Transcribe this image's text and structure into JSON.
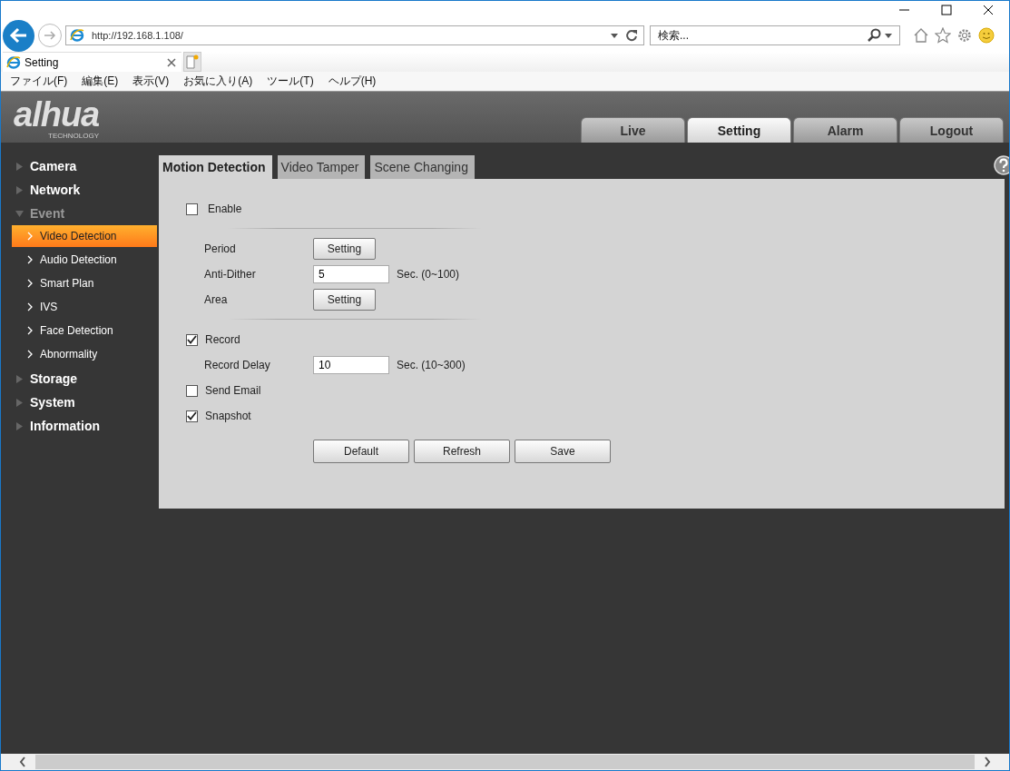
{
  "browser": {
    "url": "http://192.168.1.108/",
    "search": {
      "placeholder": "検索..."
    },
    "tab_title": "Setting",
    "menu": [
      "ファイル(F)",
      "編集(E)",
      "表示(V)",
      "お気に入り(A)",
      "ツール(T)",
      "ヘルプ(H)"
    ]
  },
  "header": {
    "logo": "alhua",
    "logo_sub": "TECHNOLOGY",
    "nav_tabs": [
      {
        "label": "Live",
        "selected": false
      },
      {
        "label": "Setting",
        "selected": true
      },
      {
        "label": "Alarm",
        "selected": false
      },
      {
        "label": "Logout",
        "selected": false
      }
    ]
  },
  "sidebar": {
    "items": [
      {
        "label": "Camera",
        "expanded": false
      },
      {
        "label": "Network",
        "expanded": false
      },
      {
        "label": "Event",
        "expanded": true,
        "children": [
          {
            "label": "Video Detection",
            "selected": true
          },
          {
            "label": "Audio Detection",
            "selected": false
          },
          {
            "label": "Smart Plan",
            "selected": false
          },
          {
            "label": "IVS",
            "selected": false
          },
          {
            "label": "Face Detection",
            "selected": false
          },
          {
            "label": "Abnormality",
            "selected": false
          }
        ]
      },
      {
        "label": "Storage",
        "expanded": false
      },
      {
        "label": "System",
        "expanded": false
      },
      {
        "label": "Information",
        "expanded": false
      }
    ]
  },
  "content": {
    "tabs": [
      {
        "label": "Motion Detection",
        "selected": true
      },
      {
        "label": "Video Tamper",
        "selected": false
      },
      {
        "label": "Scene Changing",
        "selected": false
      }
    ],
    "rows": [
      {
        "kind": "checkbox",
        "label": "Enable",
        "checked": false
      },
      {
        "kind": "divider"
      },
      {
        "kind": "button",
        "label": "Period",
        "button": "Setting"
      },
      {
        "kind": "input",
        "label": "Anti-Dither",
        "value": "5",
        "unit": "Sec. (0~100)"
      },
      {
        "kind": "button",
        "label": "Area",
        "button": "Setting"
      },
      {
        "kind": "divider"
      },
      {
        "kind": "checkbox",
        "label": "Record",
        "checked": true
      },
      {
        "kind": "input",
        "label": "Record Delay",
        "value": "10",
        "unit": "Sec. (10~300)"
      },
      {
        "kind": "checkbox",
        "label": "Send Email",
        "checked": false
      },
      {
        "kind": "checkbox",
        "label": "Snapshot",
        "checked": true
      }
    ],
    "buttons": [
      "Default",
      "Refresh",
      "Save"
    ]
  }
}
